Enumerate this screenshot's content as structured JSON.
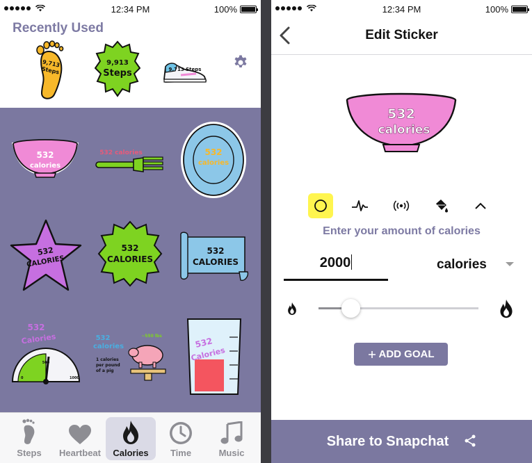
{
  "status_left": {
    "time": "12:34 PM",
    "battery": "100%"
  },
  "status_right": {
    "time": "12:34 PM",
    "battery": "100%"
  },
  "recent": {
    "title": "Recently Used",
    "foot_sticker": {
      "line1": "9,713",
      "line2": "Steps"
    },
    "badge_sticker": {
      "line1": "9,913",
      "line2": "Steps"
    },
    "shoe_sticker": {
      "text": "9,713 Steps"
    }
  },
  "grid": {
    "bowl": {
      "line1": "532",
      "line2": "calories"
    },
    "fork": {
      "text": "532 calories"
    },
    "plate": {
      "line1": "532",
      "line2": "calories"
    },
    "star": {
      "line1": "532",
      "line2": "CALORIES"
    },
    "badge": {
      "line1": "532",
      "line2": "CALORIES"
    },
    "scroll": {
      "line1": "532",
      "line2": "CALORIES"
    },
    "gauge": {
      "line1": "532",
      "line2": "Calories",
      "tick_low": "0",
      "tick_mid": "500",
      "tick_high": "1000"
    },
    "pig": {
      "line1": "532",
      "line2": "calories",
      "weight": "~550 lbs",
      "desc1": "1 calories",
      "desc2": "per pound",
      "desc3": "of a pig"
    },
    "beaker": {
      "line1": "532",
      "line2": "Calories"
    }
  },
  "tabs": [
    {
      "label": "Steps",
      "icon": "footprint-icon"
    },
    {
      "label": "Heartbeat",
      "icon": "heart-icon"
    },
    {
      "label": "Calories",
      "icon": "flame-icon"
    },
    {
      "label": "Time",
      "icon": "clock-icon"
    },
    {
      "label": "Music",
      "icon": "music-note-icon"
    }
  ],
  "active_tab": "Calories",
  "editor": {
    "title": "Edit Sticker",
    "preview": {
      "line1": "532",
      "line2": "calories"
    },
    "prompt": "Enter your amount of calories",
    "amount": "2000",
    "unit": "calories",
    "slider_fraction": 0.2,
    "add_goal": "ADD GOAL",
    "share": "Share to Snapchat"
  },
  "colors": {
    "accent": "#7b78a0",
    "tool_highlight": "#fff54f",
    "sticker_pink": "#f08ad6",
    "sticker_green": "#7ed321"
  }
}
